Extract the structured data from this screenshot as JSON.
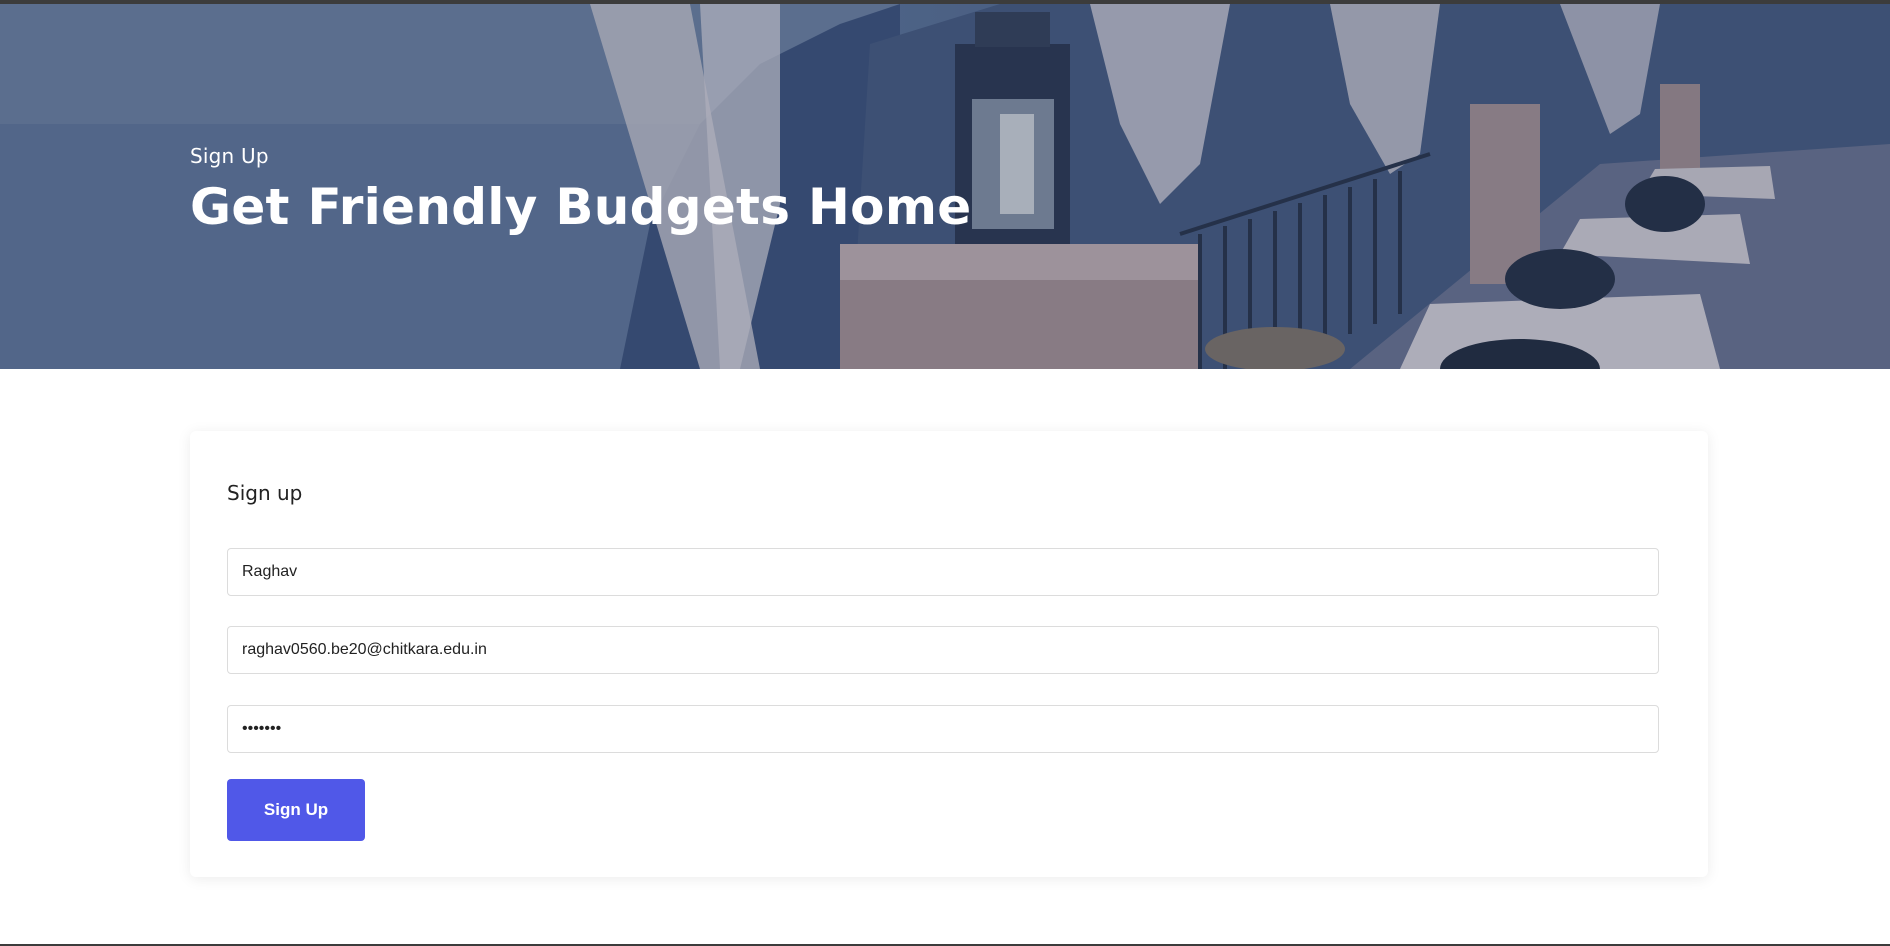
{
  "hero": {
    "subtitle": "Sign Up",
    "title": "Get Friendly Budgets Home"
  },
  "form": {
    "heading": "Sign up",
    "name_value": "Raghav",
    "email_value": "raghav0560.be20@chitkara.edu.in",
    "password_value": "•••••••",
    "submit_label": "Sign Up"
  },
  "colors": {
    "accent": "#5058e8",
    "hero_overlay": "#4f6384"
  }
}
